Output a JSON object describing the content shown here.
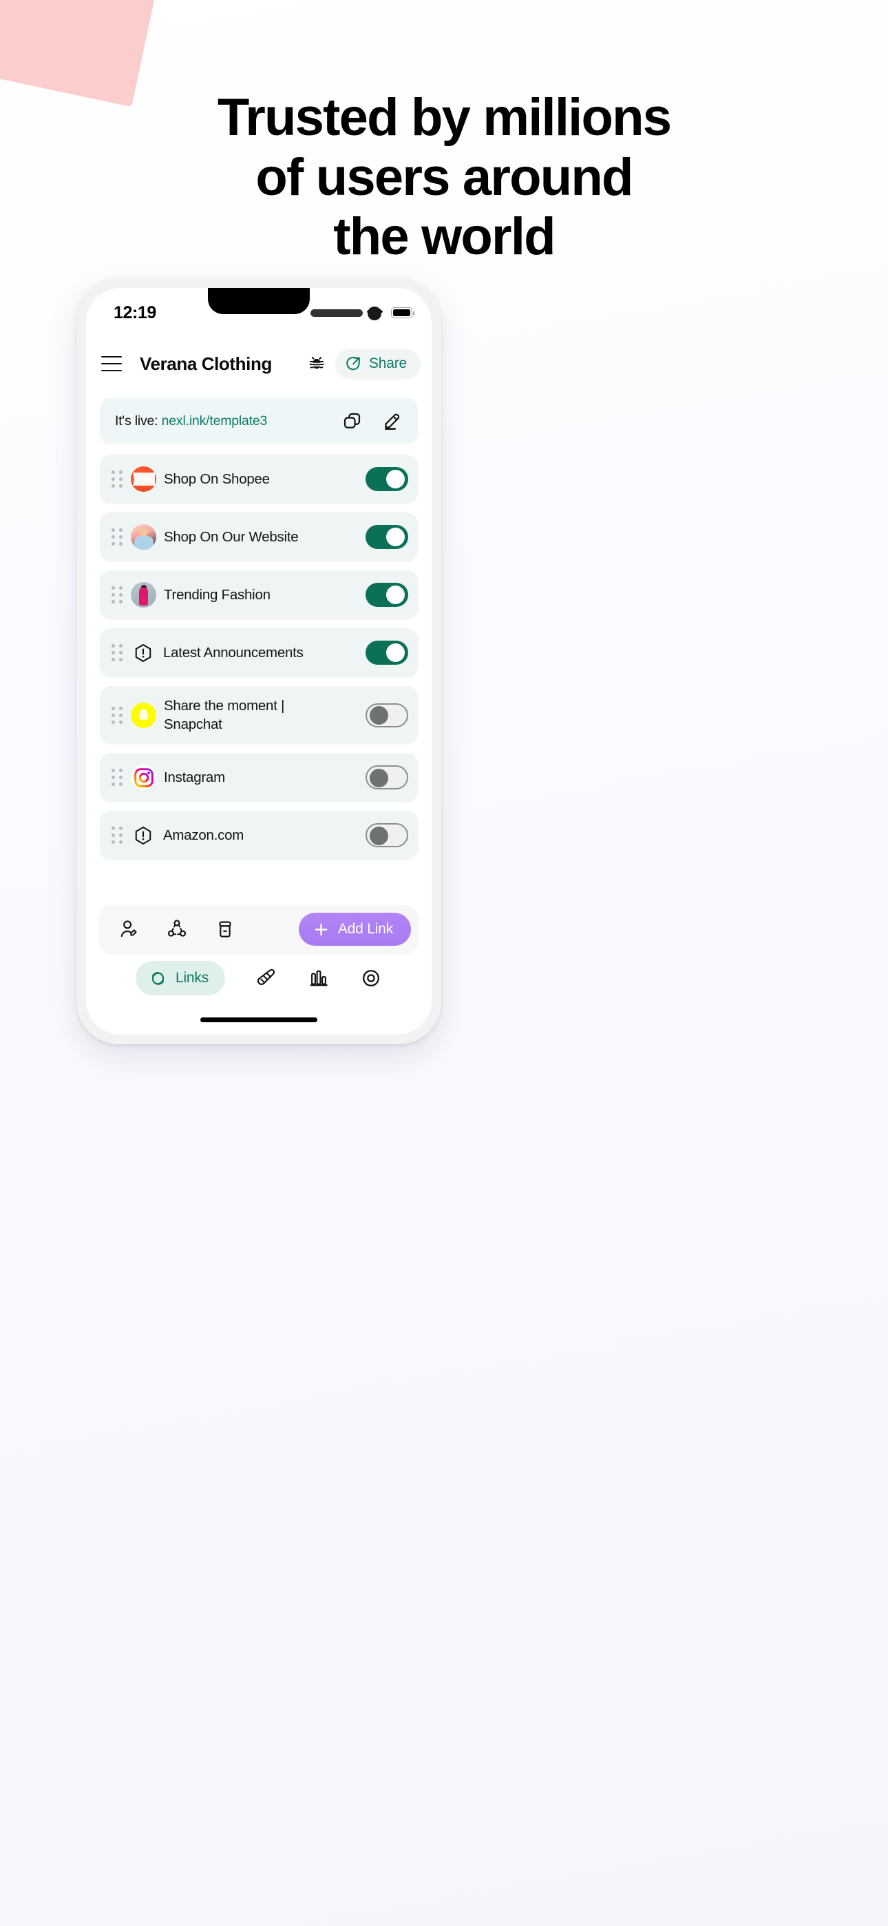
{
  "page": {
    "headline_line1": "Trusted by millions",
    "headline_line2": "of users around",
    "headline_line3": "the world",
    "accent_pink": "#fbcdcd",
    "brand_green": "#0a7158",
    "brand_purple": "#a87bf2"
  },
  "status_bar": {
    "time": "12:19",
    "wifi_icon": "wifi-icon",
    "battery_icon": "battery-icon",
    "signal_icon": "signal-dots-icon"
  },
  "app_header": {
    "menu_icon": "hamburger-menu-icon",
    "title": "Verana Clothing",
    "bug_icon": "bug-icon",
    "share_label": "Share",
    "share_icon": "share-arrow-icon"
  },
  "live_banner": {
    "prefix": "It's live:",
    "url": "nexl.ink/template3",
    "copy_icon": "copy-icon",
    "edit_icon": "pencil-edit-icon"
  },
  "links": [
    {
      "label": "Shop On Shopee",
      "icon": "shopee-logo-icon",
      "avatar_kind": "shopee",
      "toggle": "on",
      "two_line": false
    },
    {
      "label": "Shop On Our Website",
      "icon": "website-photo-icon",
      "avatar_kind": "website",
      "toggle": "on",
      "two_line": false
    },
    {
      "label": "Trending Fashion",
      "icon": "fashion-photo-icon",
      "avatar_kind": "fashion",
      "toggle": "on",
      "two_line": false
    },
    {
      "label": "Latest Announcements",
      "icon": "alert-hexagon-icon",
      "avatar_kind": "alert",
      "toggle": "on",
      "two_line": false
    },
    {
      "label": "Share the moment |",
      "label_line2": "Snapchat",
      "icon": "snapchat-logo-icon",
      "avatar_kind": "snapchat",
      "toggle": "off",
      "two_line": true
    },
    {
      "label": "Instagram",
      "icon": "instagram-logo-icon",
      "avatar_kind": "instagram",
      "toggle": "off",
      "two_line": false
    },
    {
      "label": "Amazon.com",
      "icon": "alert-hexagon-icon",
      "avatar_kind": "alert",
      "toggle": "off",
      "two_line": false
    }
  ],
  "action_bar": {
    "profile_icon": "edit-profile-icon",
    "share_nodes_icon": "share-network-icon",
    "archive_icon": "archive-box-icon",
    "add_link_label": "Add Link",
    "add_link_icon": "plus-icon"
  },
  "tab_bar": {
    "links_label": "Links",
    "links_icon": "chain-links-icon",
    "design_icon": "paintbrush-icon",
    "analytics_icon": "bar-chart-icon",
    "preview_icon": "eye-target-icon"
  }
}
